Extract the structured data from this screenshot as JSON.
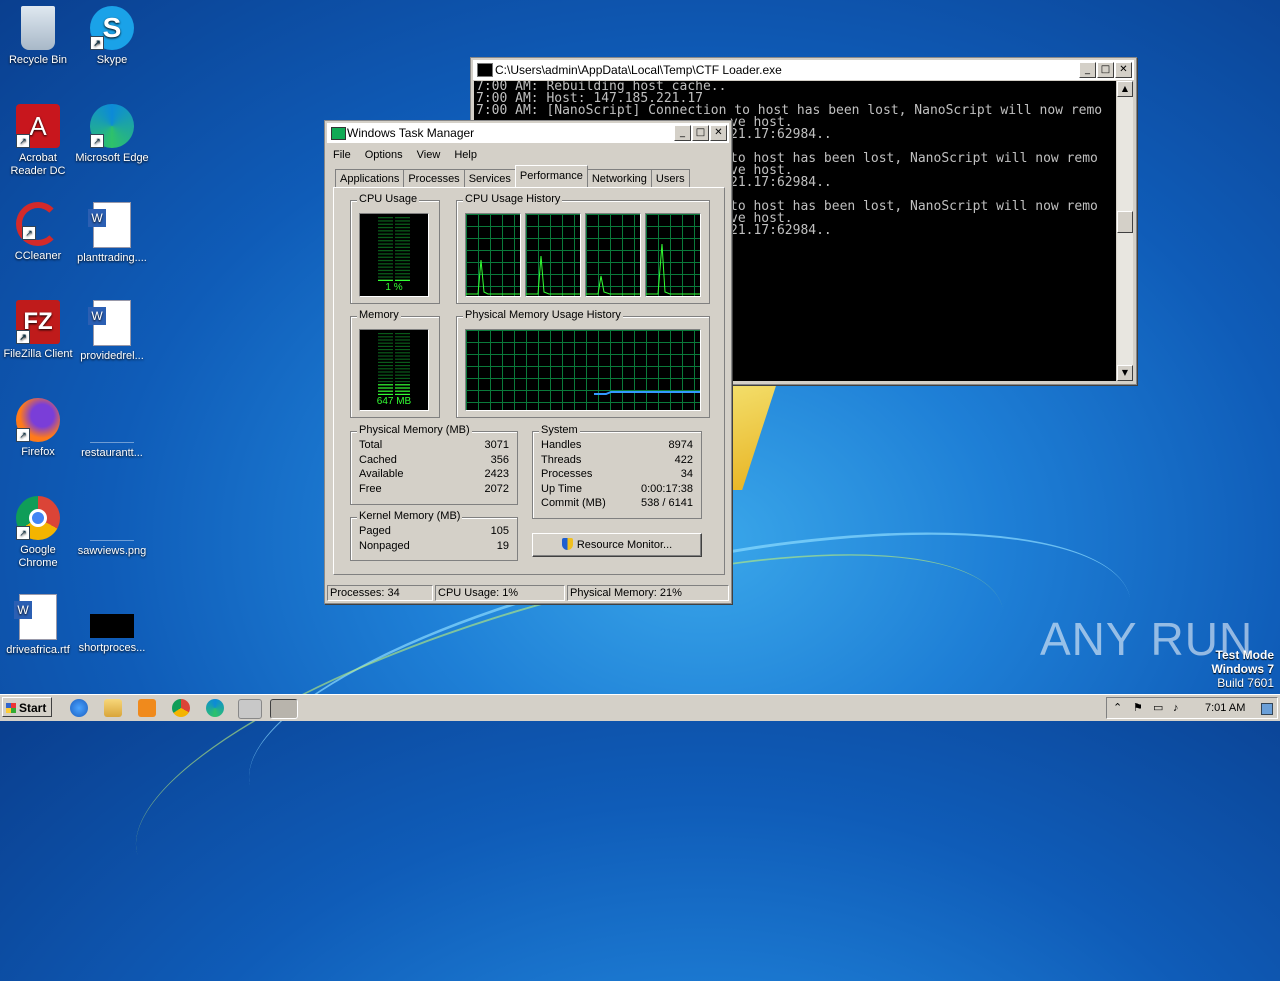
{
  "desktop": {
    "icons": [
      {
        "label": "Recycle Bin"
      },
      {
        "label": "Skype"
      },
      {
        "label": "Acrobat Reader DC"
      },
      {
        "label": "Microsoft Edge"
      },
      {
        "label": "CCleaner"
      },
      {
        "label": "planttrading...."
      },
      {
        "label": "FileZilla Client"
      },
      {
        "label": "providedrel..."
      },
      {
        "label": "Firefox"
      },
      {
        "label": "restaurantt..."
      },
      {
        "label": "Google Chrome"
      },
      {
        "label": "sawviews.png"
      },
      {
        "label": "driveafrica.rtf"
      },
      {
        "label": "shortproces..."
      }
    ]
  },
  "console": {
    "title": "C:\\Users\\admin\\AppData\\Local\\Temp\\CTF Loader.exe",
    "lines": [
      "7:00 AM: Rebuilding host cache..",
      "7:00 AM: Host: 147.185.221.17",
      "7:00 AM: [NanoScript] Connection to host has been lost, NanoScript will now remo",
      "ve host.",
      "21.17:62984..",
      "",
      "to host has been lost, NanoScript will now remo",
      "ve host.",
      "21.17:62984..",
      "",
      "to host has been lost, NanoScript will now remo",
      "ve host.",
      "21.17:62984.."
    ]
  },
  "taskmgr": {
    "title": "Windows Task Manager",
    "menu": [
      "File",
      "Options",
      "View",
      "Help"
    ],
    "tabs": [
      "Applications",
      "Processes",
      "Services",
      "Performance",
      "Networking",
      "Users"
    ],
    "active_tab": "Performance",
    "cpu_usage_label": "CPU Usage",
    "cpu_usage_value": "1 %",
    "cpu_history_label": "CPU Usage History",
    "memory_label": "Memory",
    "memory_value": "647 MB",
    "phys_history_label": "Physical Memory Usage History",
    "physical_memory": {
      "label": "Physical Memory (MB)",
      "rows": [
        {
          "k": "Total",
          "v": "3071"
        },
        {
          "k": "Cached",
          "v": "356"
        },
        {
          "k": "Available",
          "v": "2423"
        },
        {
          "k": "Free",
          "v": "2072"
        }
      ]
    },
    "kernel_memory": {
      "label": "Kernel Memory (MB)",
      "rows": [
        {
          "k": "Paged",
          "v": "105"
        },
        {
          "k": "Nonpaged",
          "v": "19"
        }
      ]
    },
    "system": {
      "label": "System",
      "rows": [
        {
          "k": "Handles",
          "v": "8974"
        },
        {
          "k": "Threads",
          "v": "422"
        },
        {
          "k": "Processes",
          "v": "34"
        },
        {
          "k": "Up Time",
          "v": "0:00:17:38"
        },
        {
          "k": "Commit (MB)",
          "v": "538 / 6141"
        }
      ]
    },
    "resource_monitor_button": "Resource Monitor...",
    "status": {
      "processes": "Processes: 34",
      "cpu": "CPU Usage: 1%",
      "memory": "Physical Memory: 21%"
    },
    "cpu_level": 0.01,
    "memory_level": 0.21
  },
  "watermark": "ANY RUN",
  "test_mode": {
    "line1": "Test Mode",
    "line2": "Windows 7",
    "line3": "Build 7601"
  },
  "taskbar": {
    "start_label": "Start",
    "clock": "7:01 AM"
  }
}
